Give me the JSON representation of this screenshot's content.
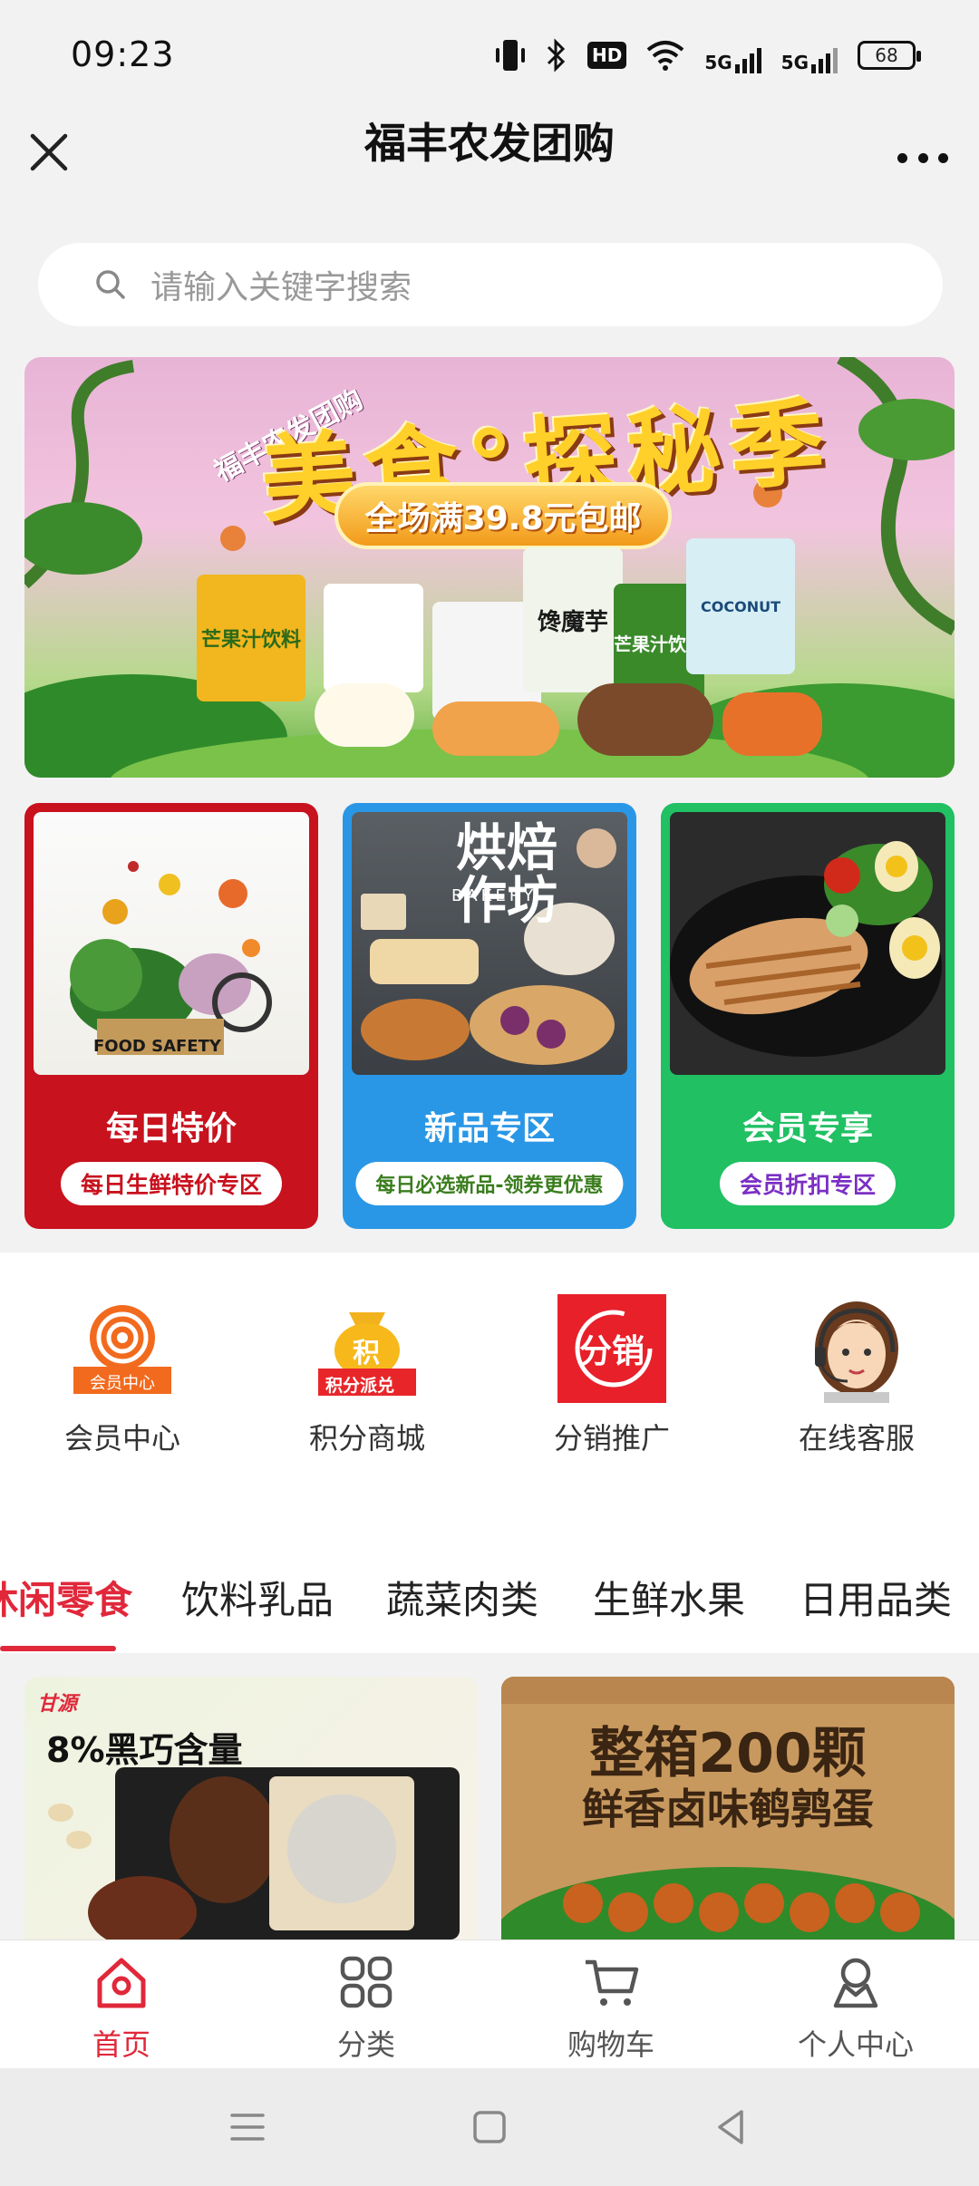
{
  "status_bar": {
    "time": "09:23",
    "hd": "HD",
    "net1": "5G",
    "net2": "5G",
    "battery": "68"
  },
  "title_bar": {
    "title": "福丰农发团购"
  },
  "search": {
    "placeholder": "请输入关键字搜索"
  },
  "banner": {
    "brand": "福丰农发团购",
    "title": "美食°探秘季",
    "promo": "全场满39.8元包邮",
    "products": [
      "芒果汁饮料",
      "馋魔芋",
      "芒果汁饮料",
      "COCONUT"
    ]
  },
  "cards": [
    {
      "photo_text": "FOOD SAFETY",
      "title": "每日特价",
      "pill": "每日生鲜特价专区",
      "pill_color": "#c8121e"
    },
    {
      "photo_text": "烘焙作坊",
      "photo_sub": "BAKERY",
      "title": "新品专区",
      "pill": "每日必选新品-领券更优惠",
      "pill_color": "#3a7d1e"
    },
    {
      "title": "会员专享",
      "pill": "会员折扣专区",
      "pill_color": "#7b2fc4"
    }
  ],
  "shortcuts": [
    {
      "label": "会员中心",
      "badge": "会员中心",
      "icon": "member-center-icon"
    },
    {
      "label": "积分商城",
      "badge": "积分派兑",
      "glyph": "积",
      "icon": "points-mall-icon"
    },
    {
      "label": "分销推广",
      "glyph": "分销",
      "icon": "distribution-icon"
    },
    {
      "label": "在线客服",
      "icon": "customer-service-icon"
    }
  ],
  "tabs": [
    "休闲零食",
    "饮料乳品",
    "蔬菜肉类",
    "生鲜水果",
    "日用品类"
  ],
  "active_tab": "休闲零食",
  "products": [
    {
      "brand": "甘源",
      "headline": "8%黑巧含量"
    },
    {
      "headline1": "整箱200颗",
      "headline2": "鲜香卤味鹌鹑蛋"
    }
  ],
  "bottom_nav": [
    {
      "label": "首页",
      "icon": "home-icon",
      "active": true
    },
    {
      "label": "分类",
      "icon": "category-icon"
    },
    {
      "label": "购物车",
      "icon": "cart-icon"
    },
    {
      "label": "个人中心",
      "icon": "user-icon"
    }
  ],
  "colors": {
    "accent": "#e0283a",
    "card_red": "#c8121e",
    "card_blue": "#2a97e6",
    "card_green": "#20c063"
  }
}
